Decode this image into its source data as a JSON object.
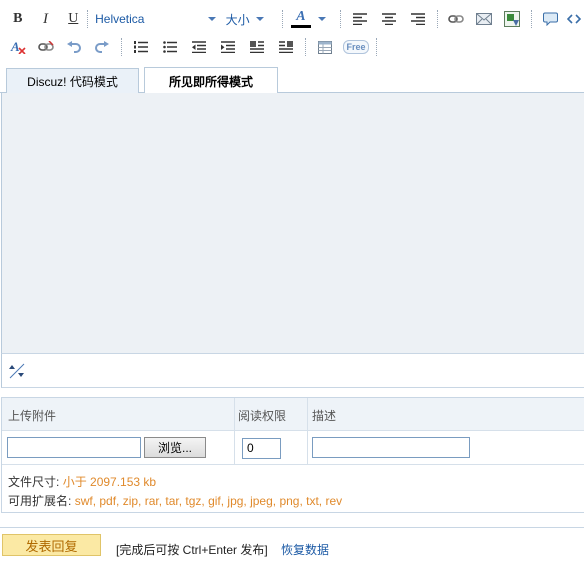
{
  "toolbar": {
    "bold_label": "B",
    "italic_label": "I",
    "underline_label": "U",
    "font_family": "Helvetica",
    "font_size": "大小",
    "font_color_label": "A",
    "insert_smiley_label": "Free"
  },
  "tabs": [
    {
      "label": "Discuz! 代码模式"
    },
    {
      "label": "所见即所得模式"
    }
  ],
  "attach": {
    "col_upload": "上传附件",
    "col_permission": "阅读权限",
    "col_description": "描述",
    "browse_label": "浏览...",
    "permission_value": "0",
    "size_label": "文件尺寸:",
    "size_value": "小于 2097.153 kb",
    "ext_label": "可用扩展名:",
    "ext_value": "swf, pdf, zip, rar, tar, tgz, gif, jpg, jpeg, png, txt, rev"
  },
  "footer": {
    "submit_label": "发表回复",
    "hint": "[完成后可按 Ctrl+Enter 发布]",
    "restore_label": "恢复数据"
  },
  "colors": {
    "accent_blue": "#1c5aa5",
    "editor_bg": "#edf1f5",
    "submit_bg": "#fbe9a4",
    "value_orange": "#e08a2c"
  }
}
